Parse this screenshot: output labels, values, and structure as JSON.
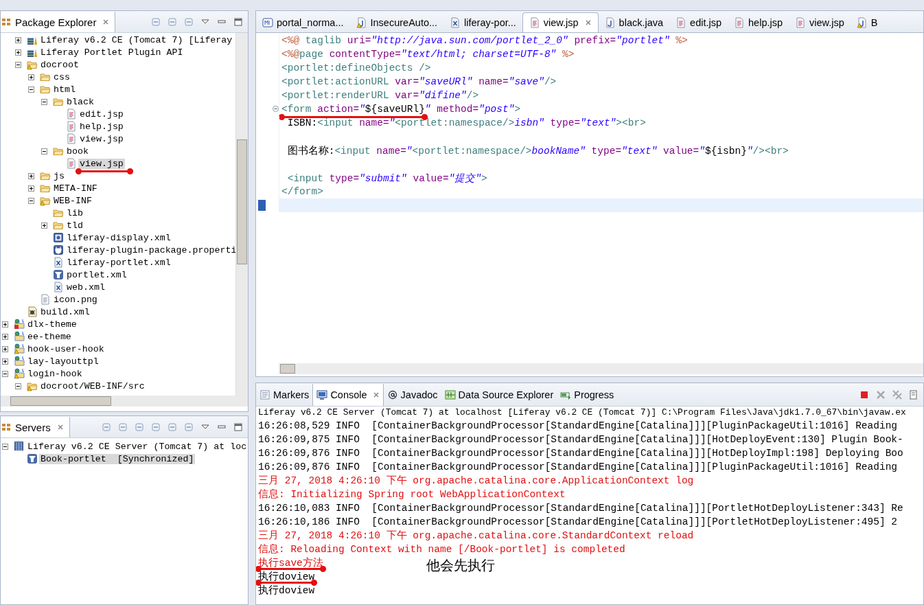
{
  "package_explorer": {
    "title": "Package Explorer",
    "continued_children": [
      {
        "label": "Liferay v6.2 CE (Tomcat 7) [Liferay",
        "kind": "library",
        "expanded": false,
        "selected": false,
        "marked": false
      },
      {
        "label": "Liferay Portlet Plugin API",
        "kind": "library",
        "expanded": false,
        "selected": false,
        "marked": false
      },
      {
        "label": "docroot",
        "kind": "folder-warn",
        "expanded": true,
        "selected": false,
        "marked": false,
        "children": [
          {
            "label": "css",
            "kind": "folder",
            "expanded": false,
            "selected": false,
            "marked": false
          },
          {
            "label": "html",
            "kind": "folder",
            "expanded": true,
            "selected": false,
            "marked": false,
            "children": [
              {
                "label": "black",
                "kind": "folder",
                "expanded": true,
                "selected": false,
                "marked": false,
                "children": [
                  {
                    "label": "edit.jsp",
                    "kind": "jsp",
                    "selected": false,
                    "marked": false
                  },
                  {
                    "label": "help.jsp",
                    "kind": "jsp",
                    "selected": false,
                    "marked": false
                  },
                  {
                    "label": "view.jsp",
                    "kind": "jsp",
                    "selected": false,
                    "marked": false
                  }
                ]
              },
              {
                "label": "book",
                "kind": "folder",
                "expanded": true,
                "selected": false,
                "marked": false,
                "children": [
                  {
                    "label": "view.jsp",
                    "kind": "jsp",
                    "selected": true,
                    "marked": true
                  }
                ]
              }
            ]
          },
          {
            "label": "js",
            "kind": "folder",
            "expanded": false,
            "selected": false,
            "marked": false
          },
          {
            "label": "META-INF",
            "kind": "folder",
            "expanded": false,
            "selected": false,
            "marked": false
          },
          {
            "label": "WEB-INF",
            "kind": "folder-warn",
            "expanded": true,
            "selected": false,
            "marked": false,
            "children": [
              {
                "label": "lib",
                "kind": "folder",
                "selected": false,
                "marked": false
              },
              {
                "label": "tld",
                "kind": "folder",
                "expanded": false,
                "selected": false,
                "marked": false
              },
              {
                "label": "liferay-display.xml",
                "kind": "display",
                "selected": false,
                "marked": false
              },
              {
                "label": "liferay-plugin-package.properti",
                "kind": "plugin",
                "selected": false,
                "marked": false
              },
              {
                "label": "liferay-portlet.xml",
                "kind": "xml",
                "selected": false,
                "marked": false
              },
              {
                "label": "portlet.xml",
                "kind": "portlet",
                "selected": false,
                "marked": false
              },
              {
                "label": "web.xml",
                "kind": "xml",
                "selected": false,
                "marked": false
              }
            ]
          },
          {
            "label": "icon.png",
            "kind": "png",
            "selected": false,
            "marked": false
          }
        ]
      },
      {
        "label": "build.xml",
        "kind": "build",
        "selected": false,
        "marked": false
      }
    ],
    "items": [
      {
        "label": "dlx-theme",
        "kind": "project-error",
        "expanded": false,
        "selected": false,
        "marked": false
      },
      {
        "label": "ee-theme",
        "kind": "project",
        "expanded": false,
        "selected": false,
        "marked": false
      },
      {
        "label": "hook-user-hook",
        "kind": "project-warn",
        "expanded": false,
        "selected": false,
        "marked": false
      },
      {
        "label": "lay-layouttpl",
        "kind": "project",
        "expanded": false,
        "selected": false,
        "marked": false
      },
      {
        "label": "login-hook",
        "kind": "project-warn",
        "expanded": true,
        "selected": false,
        "marked": false,
        "children": [
          {
            "label": "docroot/WEB-INF/src",
            "kind": "source-warn",
            "expanded": true,
            "selected": false,
            "marked": false
          }
        ]
      }
    ]
  },
  "servers": {
    "title": "Servers",
    "items": [
      {
        "label": "Liferay v6.2 CE Server (Tomcat 7) at loc",
        "kind": "server",
        "expanded": true,
        "selected": false,
        "marked": false,
        "children": [
          {
            "label": "Book-portlet  [Synchronized]",
            "kind": "portlet",
            "selected": true,
            "marked": false
          }
        ]
      }
    ]
  },
  "editor": {
    "tabs": [
      {
        "label": "portal_norma...",
        "kind": "ftl",
        "selected": false
      },
      {
        "label": "InsecureAuto...",
        "kind": "java-warn",
        "selected": false
      },
      {
        "label": "liferay-por...",
        "kind": "xml",
        "selected": false
      },
      {
        "label": "view.jsp",
        "kind": "jsp",
        "selected": true
      },
      {
        "label": "black.java",
        "kind": "java",
        "selected": false
      },
      {
        "label": "edit.jsp",
        "kind": "jsp",
        "selected": false
      },
      {
        "label": "help.jsp",
        "kind": "jsp",
        "selected": false
      },
      {
        "label": "view.jsp",
        "kind": "jsp",
        "selected": false
      },
      {
        "label": "B",
        "kind": "java-warn",
        "selected": false
      }
    ],
    "lines": [
      {
        "kind": "code",
        "current": false,
        "folding": false,
        "tokens": [
          {
            "kind": "d",
            "text": "<%@ "
          },
          {
            "kind": "t",
            "text": "taglib "
          },
          {
            "kind": "a",
            "text": "uri="
          },
          {
            "kind": "v",
            "text": "\"http://java.sun.com/portlet_2_0\""
          },
          {
            "kind": "a",
            "text": " prefix="
          },
          {
            "kind": "v",
            "text": "\"portlet\""
          },
          {
            "kind": "d",
            "text": " %>"
          }
        ]
      },
      {
        "kind": "code",
        "current": false,
        "folding": false,
        "tokens": [
          {
            "kind": "d",
            "text": "<%@"
          },
          {
            "kind": "t",
            "text": "page "
          },
          {
            "kind": "a",
            "text": "contentType="
          },
          {
            "kind": "v",
            "text": "\"text/html; charset=UTF-8\""
          },
          {
            "kind": "d",
            "text": " %>"
          }
        ]
      },
      {
        "kind": "code",
        "current": false,
        "folding": false,
        "tokens": [
          {
            "kind": "t",
            "text": "<portlet:defineObjects />"
          }
        ]
      },
      {
        "kind": "code",
        "current": false,
        "folding": false,
        "tokens": [
          {
            "kind": "t",
            "text": "<portlet:actionURL "
          },
          {
            "kind": "a",
            "text": "var="
          },
          {
            "kind": "v",
            "text": "\"saveURl\""
          },
          {
            "kind": "a",
            "text": " name="
          },
          {
            "kind": "v",
            "text": "\"save\""
          },
          {
            "kind": "t",
            "text": "/>"
          }
        ]
      },
      {
        "kind": "code",
        "current": false,
        "folding": false,
        "tokens": [
          {
            "kind": "t",
            "text": "<portlet:renderURL "
          },
          {
            "kind": "a",
            "text": "var="
          },
          {
            "kind": "v",
            "text": "\"difine\""
          },
          {
            "kind": "t",
            "text": "/>"
          }
        ]
      },
      {
        "kind": "code",
        "current": false,
        "folding": true,
        "tokens": [
          {
            "kind": "t",
            "text": "<form",
            "marked": true
          },
          {
            "kind": "a",
            "text": " action=",
            "marked": true
          },
          {
            "kind": "v",
            "text": "\"",
            "marked": true
          },
          {
            "kind": "p",
            "text": "${saveURl}",
            "marked": true
          },
          {
            "kind": "v",
            "text": "\""
          },
          {
            "kind": "a",
            "text": " method="
          },
          {
            "kind": "v",
            "text": "\"post\""
          },
          {
            "kind": "t",
            "text": ">"
          }
        ]
      },
      {
        "kind": "code",
        "current": false,
        "folding": false,
        "tokens": [
          {
            "kind": "p",
            "text": " ISBN:"
          },
          {
            "kind": "t",
            "text": "<input "
          },
          {
            "kind": "a",
            "text": "name="
          },
          {
            "kind": "v",
            "text": "\""
          },
          {
            "kind": "t",
            "text": "<portlet:namespace/>"
          },
          {
            "kind": "v",
            "text": "isbn\""
          },
          {
            "kind": "a",
            "text": " type="
          },
          {
            "kind": "v",
            "text": "\"text\""
          },
          {
            "kind": "t",
            "text": "><br>"
          }
        ]
      },
      {
        "kind": "blank",
        "current": false
      },
      {
        "kind": "code",
        "current": false,
        "folding": false,
        "tokens": [
          {
            "kind": "p",
            "text": " 图书名称:"
          },
          {
            "kind": "t",
            "text": "<input "
          },
          {
            "kind": "a",
            "text": "name="
          },
          {
            "kind": "v",
            "text": "\""
          },
          {
            "kind": "t",
            "text": "<portlet:namespace/>"
          },
          {
            "kind": "v",
            "text": "bookName\""
          },
          {
            "kind": "a",
            "text": " type="
          },
          {
            "kind": "v",
            "text": "\"text\""
          },
          {
            "kind": "a",
            "text": " value="
          },
          {
            "kind": "v",
            "text": "\""
          },
          {
            "kind": "p",
            "text": "${isbn}"
          },
          {
            "kind": "v",
            "text": "\""
          },
          {
            "kind": "t",
            "text": "/><br>"
          }
        ]
      },
      {
        "kind": "blank",
        "current": false
      },
      {
        "kind": "code",
        "current": false,
        "folding": false,
        "tokens": [
          {
            "kind": "t",
            "text": " <input "
          },
          {
            "kind": "a",
            "text": "type="
          },
          {
            "kind": "v",
            "text": "\"submit\""
          },
          {
            "kind": "a",
            "text": " value="
          },
          {
            "kind": "v",
            "text": "\"提交\""
          },
          {
            "kind": "t",
            "text": ">"
          }
        ]
      },
      {
        "kind": "code",
        "current": false,
        "folding": false,
        "tokens": [
          {
            "kind": "t",
            "text": "</form>"
          }
        ]
      },
      {
        "kind": "blank",
        "current": true
      }
    ]
  },
  "console": {
    "tabs": [
      {
        "label": "Markers",
        "kind": "markers",
        "selected": false
      },
      {
        "label": "Console",
        "kind": "console",
        "selected": true
      },
      {
        "label": "Javadoc",
        "kind": "javadoc",
        "selected": false
      },
      {
        "label": "Data Source Explorer",
        "kind": "datasource",
        "selected": false
      },
      {
        "label": "Progress",
        "kind": "progress",
        "selected": false
      }
    ],
    "header": "Liferay v6.2 CE Server (Tomcat 7) at localhost [Liferay v6.2 CE (Tomcat 7)] C:\\Program Files\\Java\\jdk1.7.0_67\\bin\\javaw.ex",
    "lines": [
      {
        "kind": "info",
        "marked": false,
        "text": "16:26:08,529 INFO  [ContainerBackgroundProcessor[StandardEngine[Catalina]]][PluginPackageUtil:1016] Reading"
      },
      {
        "kind": "info",
        "marked": false,
        "text": "16:26:09,875 INFO  [ContainerBackgroundProcessor[StandardEngine[Catalina]]][HotDeployEvent:130] Plugin Book-"
      },
      {
        "kind": "info",
        "marked": false,
        "text": "16:26:09,876 INFO  [ContainerBackgroundProcessor[StandardEngine[Catalina]]][HotDeployImpl:198] Deploying Boo"
      },
      {
        "kind": "info",
        "marked": false,
        "text": "16:26:09,876 INFO  [ContainerBackgroundProcessor[StandardEngine[Catalina]]][PluginPackageUtil:1016] Reading"
      },
      {
        "kind": "error",
        "marked": false,
        "text": "三月 27, 2018 4:26:10 下午 org.apache.catalina.core.ApplicationContext log"
      },
      {
        "kind": "error",
        "marked": false,
        "text": "信息: Initializing Spring root WebApplicationContext"
      },
      {
        "kind": "info",
        "marked": false,
        "text": "16:26:10,083 INFO  [ContainerBackgroundProcessor[StandardEngine[Catalina]]][PortletHotDeployListener:343] Re"
      },
      {
        "kind": "info",
        "marked": false,
        "text": "16:26:10,186 INFO  [ContainerBackgroundProcessor[StandardEngine[Catalina]]][PortletHotDeployListener:495] 2"
      },
      {
        "kind": "error",
        "marked": false,
        "text": "三月 27, 2018 4:26:10 下午 org.apache.catalina.core.StandardContext reload"
      },
      {
        "kind": "error",
        "marked": false,
        "text": "信息: Reloading Context with name [/Book-portlet] is completed"
      },
      {
        "kind": "error",
        "marked": true,
        "text": "执行save方法"
      },
      {
        "kind": "info",
        "marked": true,
        "text": "执行doview"
      },
      {
        "kind": "info",
        "marked": false,
        "text": "执行doview"
      }
    ],
    "annotation": "他会先执行"
  }
}
